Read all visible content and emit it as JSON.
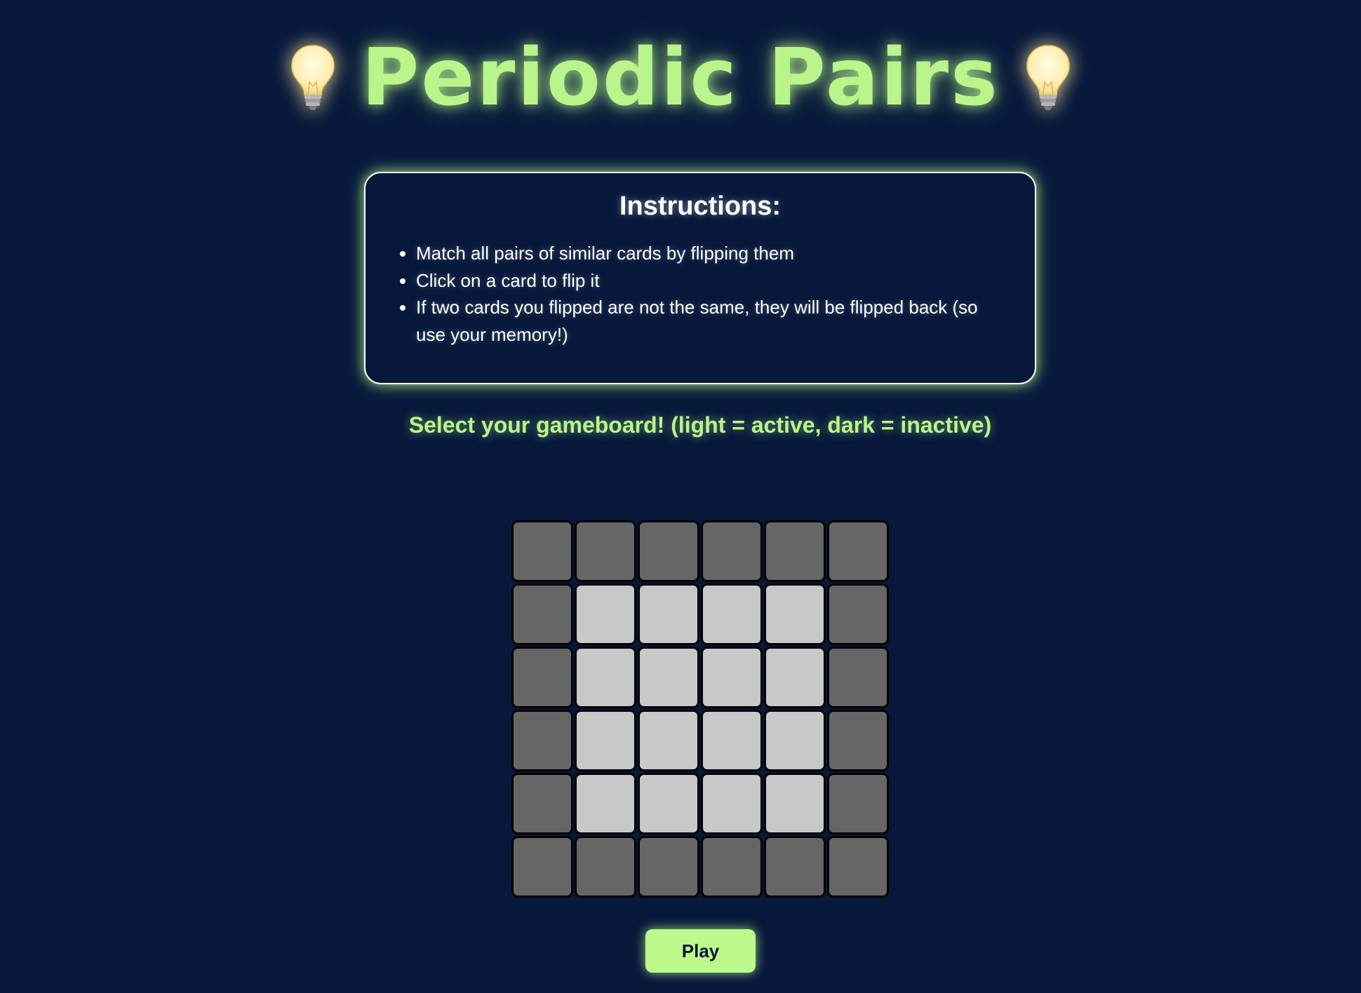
{
  "header": {
    "title": "Periodic Pairs",
    "left_icon": "lightbulb-icon",
    "right_icon": "lightbulb-icon"
  },
  "instructions": {
    "heading": "Instructions:",
    "items": [
      "Match all pairs of similar cards by flipping them",
      "Click on a card to flip it",
      "If two cards you flipped are not the same, they will be flipped back (so use your memory!)"
    ]
  },
  "board_prompt": "Select your gameboard! (light = active, dark = inactive)",
  "board": {
    "rows": 6,
    "cols": 6,
    "cells": [
      [
        0,
        0,
        0,
        0,
        0,
        0
      ],
      [
        0,
        1,
        1,
        1,
        1,
        0
      ],
      [
        0,
        1,
        1,
        1,
        1,
        0
      ],
      [
        0,
        1,
        1,
        1,
        1,
        0
      ],
      [
        0,
        1,
        1,
        1,
        1,
        0
      ],
      [
        0,
        0,
        0,
        0,
        0,
        0
      ]
    ],
    "active_color": "#c8c8c8",
    "inactive_color": "#666666"
  },
  "play_button": {
    "label": "Play"
  },
  "colors": {
    "background": "#07183b",
    "accent": "#b9f58a",
    "button": "#bdf98d"
  }
}
